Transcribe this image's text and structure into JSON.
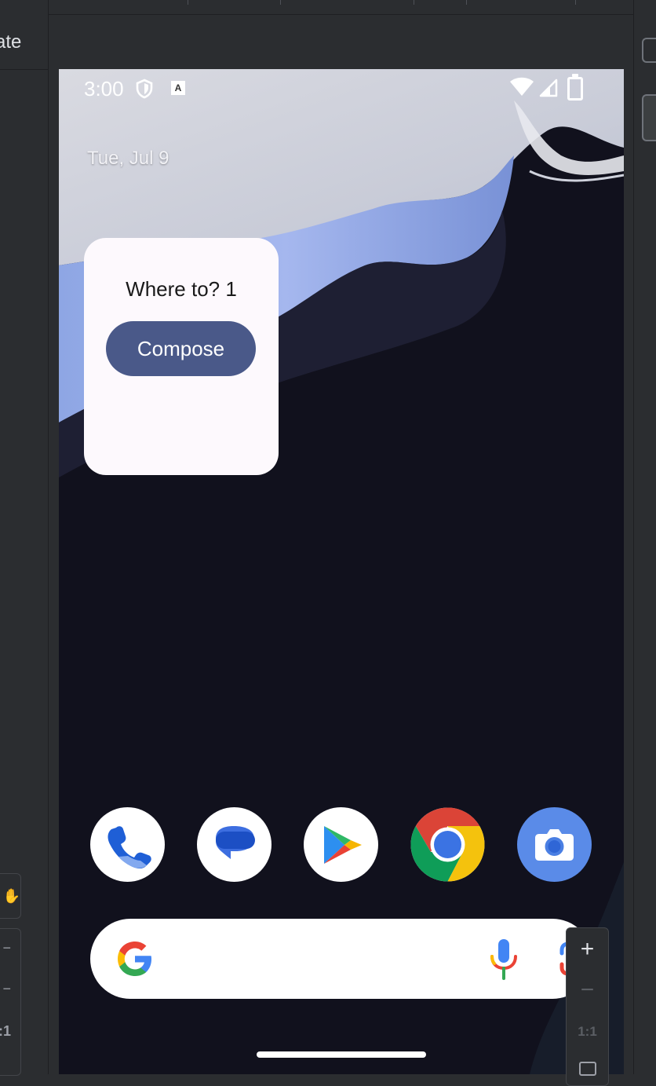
{
  "ide": {
    "left_tab_partial_label": "ate",
    "zoom_controls": {
      "zoom_in": "+",
      "zoom_out": "−",
      "actual_size": "1:1"
    },
    "left_tools": {
      "pan": "✋",
      "plus": "−",
      "minus": "−",
      "ratio": ":1"
    }
  },
  "status_bar": {
    "time": "3:00",
    "icons": [
      "shield-icon",
      "a-notification-icon",
      "wifi-icon",
      "cell-signal-icon",
      "battery-icon"
    ],
    "notification_letter": "A"
  },
  "home": {
    "date": "Tue, Jul 9"
  },
  "widget": {
    "title": "Where to? 1",
    "button_label": "Compose",
    "background": "#fdf9fd",
    "button_color": "#4a5989"
  },
  "dock": {
    "apps": [
      "phone-app-icon",
      "messages-app-icon",
      "play-store-app-icon",
      "chrome-app-icon",
      "camera-app-icon"
    ]
  },
  "search_bar": {
    "icons": [
      "google-g-icon",
      "mic-icon",
      "lens-icon"
    ]
  }
}
